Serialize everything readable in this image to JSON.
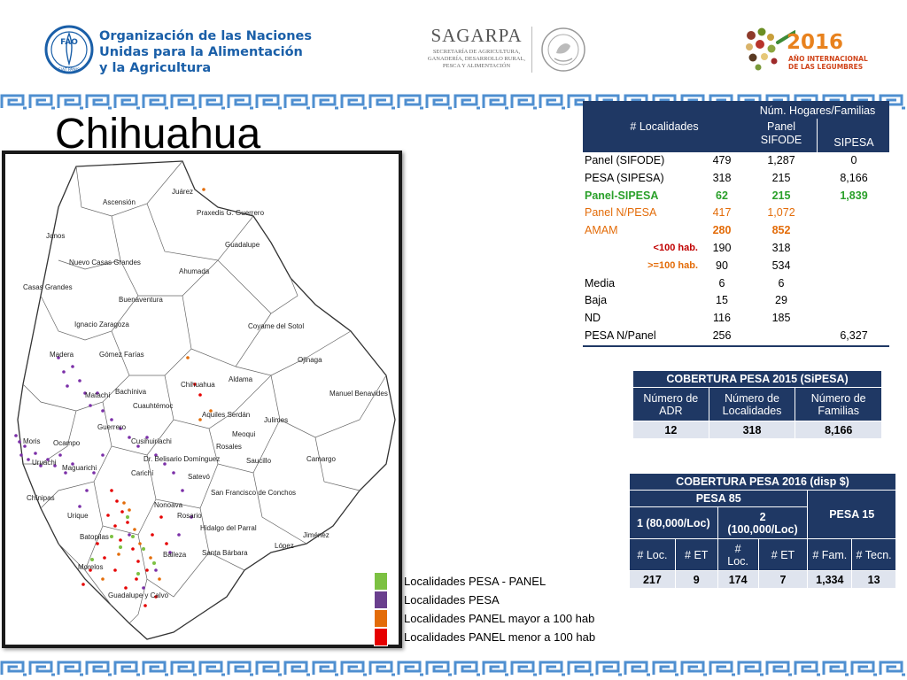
{
  "header": {
    "fao": {
      "logo_text": "FAO",
      "logo_motto": "FIAT PANIS",
      "line1": "Organización de las Naciones",
      "line2": "Unidas para la Alimentación",
      "line3": "y la Agricultura"
    },
    "sagarpa": {
      "name": "SAGARPA",
      "sub1": "SECRETARÍA DE AGRICULTURA,",
      "sub2": "GANADERÍA, DESARROLLO RURAL,",
      "sub3": "PESCA Y ALIMENTACIÓN"
    },
    "legumes": {
      "year": "2016",
      "sub1": "AÑO INTERNACIONAL",
      "sub2": "DE LAS LEGUMBRES"
    }
  },
  "title": "Chihuahua",
  "map": {
    "labels": [
      "Juárez",
      "Ascensión",
      "Praxedis G. Guerrero",
      "Janos",
      "Guadalupe",
      "Nuevo Casas Grandes",
      "Ahumada",
      "Casas Grandes",
      "Buenaventura",
      "Ignacio Zaragoza",
      "Coyame del Sotol",
      "Madera",
      "Gómez Farías",
      "Ojinaga",
      "Aldama",
      "Matachí",
      "Bachíniva",
      "Chihuahua",
      "Manuel Benavides",
      "Cuauhtémoc",
      "Aquiles Serdán",
      "Julimes",
      "Guerrero",
      "Meoqui",
      "Moris",
      "Ocampo",
      "Cusihuiriachi",
      "Rosales",
      "Uruachi",
      "Maguarichi",
      "Dr. Belisario Domínguez",
      "Saucillo",
      "Camargo",
      "Carichí",
      "Satevó",
      "Chínipas",
      "San Francisco de Conchos",
      "Nonoava",
      "Urique",
      "Rosario",
      "Batopilas",
      "Hidalgo del Parral",
      "Jiménez",
      "López",
      "Balleza",
      "Santa Bárbara",
      "Morelos",
      "Guadalupe y Calvo"
    ]
  },
  "legend": [
    {
      "label": "Localidades PESA - PANEL",
      "color": "#7cc142"
    },
    {
      "label": "Localidades PESA",
      "color": "#6a3f8e"
    },
    {
      "label": "Localidades PANEL mayor a 100 hab",
      "color": "#e36c09"
    },
    {
      "label": "Localidades PANEL menor a 100 hab",
      "color": "#e60000"
    }
  ],
  "table1": {
    "head_localidades": "# Localidades",
    "head_hogares": "Núm. Hogares/Familias",
    "head_panel1": "Panel",
    "head_panel2": "SIFODE",
    "head_sipesa": "SIPESA",
    "rows": [
      {
        "label": "Panel (SIFODE)",
        "loc": "479",
        "panel": "1,287",
        "sipesa": "0"
      },
      {
        "label": "PESA (SIPESA)",
        "loc": "318",
        "panel": "215",
        "sipesa": "8,166"
      },
      {
        "label": "Panel-SIPESA",
        "loc": "62",
        "panel": "215",
        "sipesa": "1,839"
      },
      {
        "label": "Panel N/PESA",
        "loc": "417",
        "panel": "1,072",
        "sipesa": ""
      },
      {
        "label": "AMAM",
        "loc": "280",
        "panel": "852",
        "sipesa": ""
      },
      {
        "label": "<100 hab.",
        "loc": "190",
        "panel": "318",
        "sipesa": ""
      },
      {
        "label": ">=100 hab.",
        "loc": "90",
        "panel": "534",
        "sipesa": ""
      },
      {
        "label": "Media",
        "loc": "6",
        "panel": "6",
        "sipesa": ""
      },
      {
        "label": "Baja",
        "loc": "15",
        "panel": "29",
        "sipesa": ""
      },
      {
        "label": "ND",
        "loc": "116",
        "panel": "185",
        "sipesa": ""
      },
      {
        "label": "PESA N/Panel",
        "loc": "256",
        "panel": "",
        "sipesa": "6,327"
      }
    ]
  },
  "table2": {
    "title": "COBERTURA  PESA 2015 (SiPESA)",
    "h1a": "Número de",
    "h1b": "ADR",
    "h2a": "Número de",
    "h2b": "Localidades",
    "h3a": "Número de",
    "h3b": "Familias",
    "v1": "12",
    "v2": "318",
    "v3": "8,166"
  },
  "table3": {
    "title": "COBERTURA PESA 2016 (disp $)",
    "pesa85": "PESA 85",
    "pesa15": "PESA 15",
    "sub1": "1 (80,000/Loc)",
    "sub2a": "2",
    "sub2b": "(100,000/Loc)",
    "c1": "#  Loc.",
    "c2": "# ET",
    "c3a": "#",
    "c3b": "Loc.",
    "c4": "# ET",
    "c5": "# Fam.",
    "c6": "# Tecn.",
    "v1": "217",
    "v2": "9",
    "v3": "174",
    "v4": "7",
    "v5": "1,334",
    "v6": "13"
  }
}
